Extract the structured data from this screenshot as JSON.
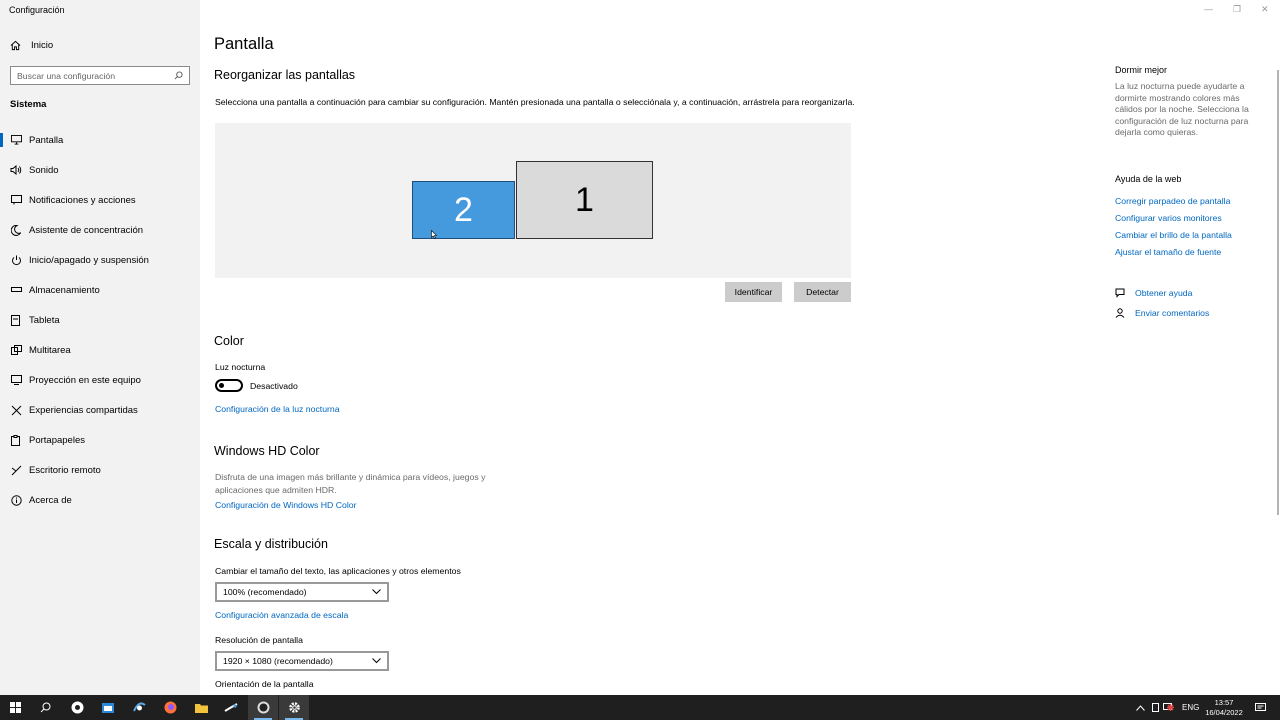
{
  "window": {
    "title": "Configuración",
    "controls": {
      "minimize": "—",
      "restore": "❐",
      "close": "✕"
    }
  },
  "sidebar": {
    "home_label": "Inicio",
    "search_placeholder": "Buscar una configuración",
    "section_label": "Sistema",
    "items": [
      {
        "label": "Pantalla",
        "icon": "monitor-icon",
        "active": true
      },
      {
        "label": "Sonido",
        "icon": "speaker-icon"
      },
      {
        "label": "Notificaciones y acciones",
        "icon": "notification-icon"
      },
      {
        "label": "Asistente de concentración",
        "icon": "moon-icon"
      },
      {
        "label": "Inicio/apagado y suspensión",
        "icon": "power-icon"
      },
      {
        "label": "Almacenamiento",
        "icon": "storage-icon"
      },
      {
        "label": "Tableta",
        "icon": "tablet-icon"
      },
      {
        "label": "Multitarea",
        "icon": "multitask-icon"
      },
      {
        "label": "Proyección en este equipo",
        "icon": "projection-icon"
      },
      {
        "label": "Experiencias compartidas",
        "icon": "shared-icon"
      },
      {
        "label": "Portapapeles",
        "icon": "clipboard-icon"
      },
      {
        "label": "Escritorio remoto",
        "icon": "remote-desktop-icon"
      },
      {
        "label": "Acerca de",
        "icon": "info-icon"
      }
    ]
  },
  "main": {
    "title": "Pantalla",
    "rearrange": {
      "heading": "Reorganizar las pantallas",
      "description": "Selecciona una pantalla a continuación para cambiar su configuración. Mantén presionada una pantalla o selecciónala y, a continuación, arrástrela para reorganizarla.",
      "monitor_2": "2",
      "monitor_1": "1",
      "identify_button": "Identificar",
      "detect_button": "Detectar"
    },
    "color": {
      "heading": "Color",
      "night_light_label": "Luz nocturna",
      "toggle_state": "Desactivado",
      "night_light_link": "Configuración de la luz nocturna"
    },
    "hdr": {
      "heading": "Windows HD Color",
      "description": "Disfruta de una imagen más brillante y dinámica para vídeos, juegos y aplicaciones que admiten HDR.",
      "link": "Configuración de Windows HD Color"
    },
    "scale": {
      "heading": "Escala y distribución",
      "text_size_label": "Cambiar el tamaño del texto, las aplicaciones y otros elementos",
      "text_size_value": "100% (recomendado)",
      "advanced_link": "Configuración avanzada de escala",
      "resolution_label": "Resolución de pantalla",
      "resolution_value": "1920 × 1080 (recomendado)",
      "orientation_label": "Orientación de la pantalla"
    }
  },
  "right_pane": {
    "sleep_heading": "Dormir mejor",
    "sleep_text": "La luz nocturna puede ayudarte a dormirte mostrando colores más cálidos por la noche. Selecciona la configuración de luz nocturna para dejarla como quieras.",
    "help_heading": "Ayuda de la web",
    "help_links": [
      "Corregir parpadeo de pantalla",
      "Configurar varios monitores",
      "Cambiar el brillo de la pantalla",
      "Ajustar el tamaño de fuente"
    ],
    "get_help": "Obtener ayuda",
    "feedback": "Enviar comentarios"
  },
  "taskbar": {
    "language": "ENG",
    "time": "13:57",
    "date": "16/04/2022"
  },
  "colors": {
    "accent": "#0067c0",
    "selected_monitor": "#4599dd",
    "sidebar_bg": "#f2f2f2",
    "taskbar_bg": "#1f1f1f"
  }
}
